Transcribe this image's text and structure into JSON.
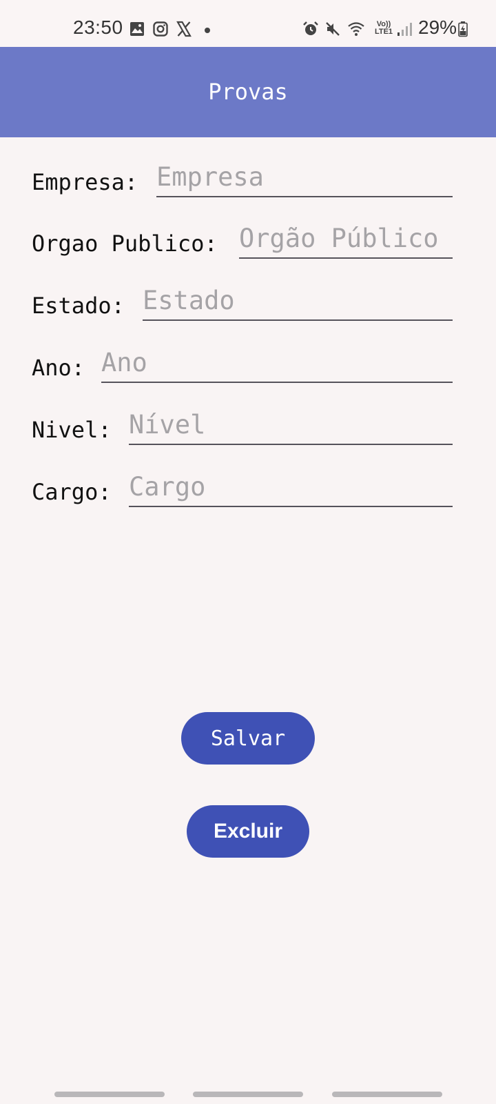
{
  "status_bar": {
    "time": "23:50",
    "battery_percent": "29%",
    "volte_line1": "Vo))",
    "volte_line2": "LTE1",
    "icons": [
      "gallery-icon",
      "instagram-icon",
      "x-icon",
      "alarm-icon",
      "mute-icon",
      "wifi-icon",
      "volte-icon",
      "signal-icon",
      "battery-charging-icon"
    ]
  },
  "app_bar": {
    "title": "Provas"
  },
  "form": {
    "fields": [
      {
        "label": "Empresa:",
        "placeholder": "Empresa",
        "value": ""
      },
      {
        "label": "Orgao Publico:",
        "placeholder": "Orgão Público",
        "value": ""
      },
      {
        "label": "Estado:",
        "placeholder": "Estado",
        "value": ""
      },
      {
        "label": "Ano:",
        "placeholder": "Ano",
        "value": ""
      },
      {
        "label": "Nivel:",
        "placeholder": "Nível",
        "value": ""
      },
      {
        "label": "Cargo:",
        "placeholder": "Cargo",
        "value": ""
      }
    ]
  },
  "actions": {
    "save_label": "Salvar",
    "delete_label": "Excluir"
  },
  "colors": {
    "app_bar": "#6c79c7",
    "button": "#3f51b5",
    "background": "#f9f4f4",
    "placeholder": "#a5a3a6"
  }
}
